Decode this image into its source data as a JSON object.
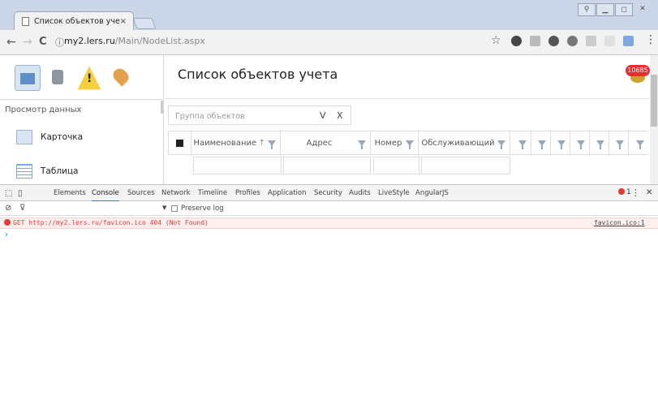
{
  "browser": {
    "tab_title": "Список объектов учета",
    "tab_close": "×",
    "url_host": "my2.lers.ru",
    "url_path": "/Main/NodeList.aspx",
    "star": "☆",
    "menu": "⋮",
    "back": "←",
    "forward": "→",
    "reload": "C",
    "info": "ⓘ"
  },
  "app": {
    "page_title": "Список объектов учета",
    "badge_count": "10685",
    "sidebar": {
      "header": "Просмотр данных",
      "items": [
        {
          "label": "Карточка",
          "icon": "card-icon"
        },
        {
          "label": "Таблица",
          "icon": "table-icon"
        }
      ],
      "toolbar_icons": [
        "home-icon",
        "tap-icon",
        "warning-icon",
        "map-pin-icon"
      ]
    },
    "filter": {
      "placeholder": "Группа объектов",
      "v": "V",
      "x": "X"
    },
    "grid": {
      "columns": [
        {
          "label": "Наименование",
          "sort": "↑"
        },
        {
          "label": "Адрес",
          "sort": ""
        },
        {
          "label": "Номер",
          "sort": ""
        },
        {
          "label": "Обслуживающий",
          "sort": ""
        }
      ]
    }
  },
  "devtools": {
    "tabs": [
      "Elements",
      "Console",
      "Sources",
      "Network",
      "Timeline",
      "Profiles",
      "Application",
      "Security",
      "Audits",
      "LiveStyle",
      "AngularJS"
    ],
    "active_tab": "Console",
    "error_count": "1",
    "preserve_log": "Preserve log",
    "error_text": "GET http://my2.lers.ru/favicon.ico 404 (Not Found)",
    "error_source": "favicon.ico:1",
    "prompt": "›",
    "close": "✕",
    "more": "⋮",
    "filter_arrow": "▼"
  }
}
